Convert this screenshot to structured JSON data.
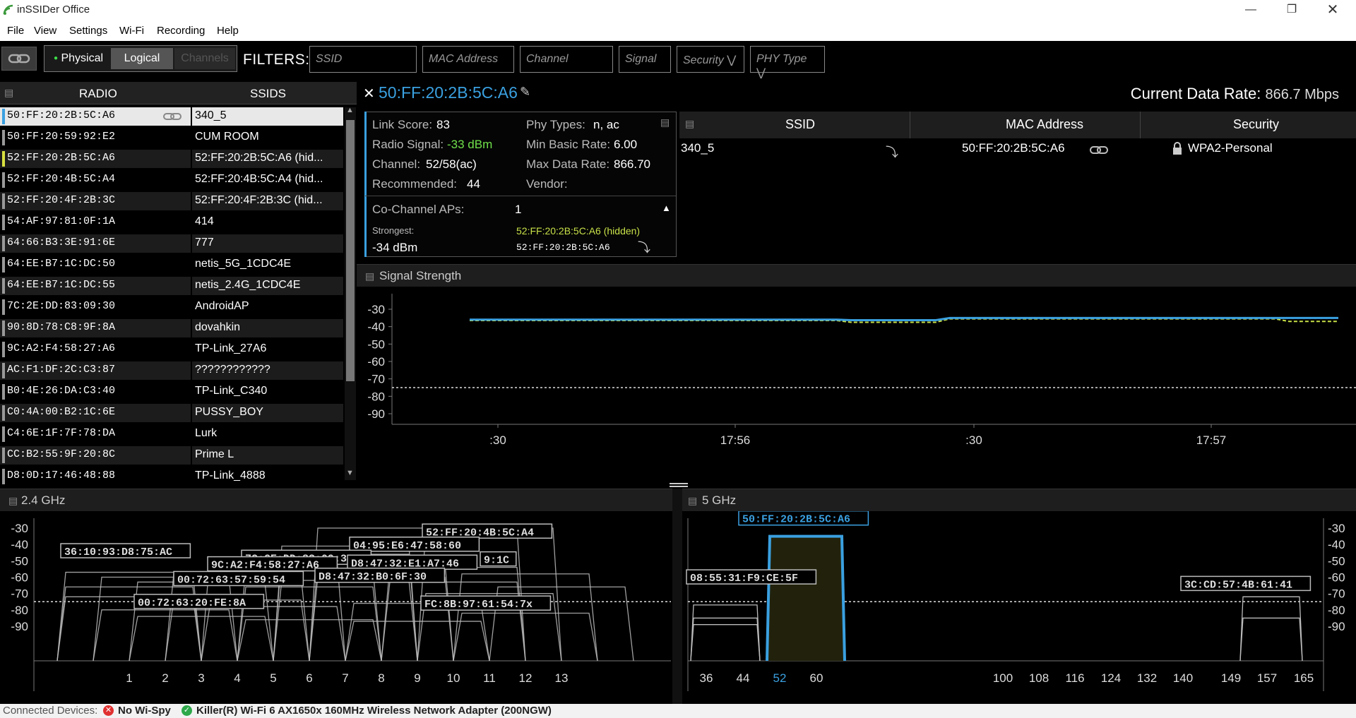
{
  "app": {
    "title": "inSSIDer Office"
  },
  "menu": [
    "File",
    "View",
    "Settings",
    "Wi-Fi",
    "Recording",
    "Help"
  ],
  "toolbar": {
    "view_physical": "Physical",
    "view_logical": "Logical",
    "view_channels": "Channels",
    "filters_label": "FILTERS:",
    "filter_ssid": "SSID",
    "filter_mac": "MAC Address",
    "filter_channel": "Channel",
    "filter_signal": "Signal",
    "filter_security": "Security",
    "filter_phy": "PHY Type"
  },
  "radiolist": {
    "col_radio": "RADIO",
    "col_ssids": "SSIDS",
    "rows": [
      {
        "mac": "50:FF:20:2B:5C:A6",
        "ssid": "340_5",
        "color": "#3aa0e0",
        "selected": true
      },
      {
        "mac": "50:FF:20:59:92:E2",
        "ssid": "CUM ROOM",
        "color": "#999999"
      },
      {
        "mac": "52:FF:20:2B:5C:A6",
        "ssid": "52:FF:20:2B:5C:A6 (hid...",
        "color": "#d8e040"
      },
      {
        "mac": "52:FF:20:4B:5C:A4",
        "ssid": "52:FF:20:4B:5C:A4 (hid...",
        "color": "#999999"
      },
      {
        "mac": "52:FF:20:4F:2B:3C",
        "ssid": "52:FF:20:4F:2B:3C (hid...",
        "color": "#999999"
      },
      {
        "mac": "54:AF:97:81:0F:1A",
        "ssid": "414",
        "color": "#999999"
      },
      {
        "mac": "64:66:B3:3E:91:6E",
        "ssid": "777",
        "color": "#999999"
      },
      {
        "mac": "64:EE:B7:1C:DC:50",
        "ssid": "netis_5G_1CDC4E",
        "color": "#999999"
      },
      {
        "mac": "64:EE:B7:1C:DC:55",
        "ssid": "netis_2.4G_1CDC4E",
        "color": "#999999"
      },
      {
        "mac": "7C:2E:DD:83:09:30",
        "ssid": "AndroidAP",
        "color": "#999999"
      },
      {
        "mac": "90:8D:78:C8:9F:8A",
        "ssid": "dovahkin",
        "color": "#999999"
      },
      {
        "mac": "9C:A2:F4:58:27:A6",
        "ssid": "TP-Link_27A6",
        "color": "#999999"
      },
      {
        "mac": "AC:F1:DF:2C:C3:87",
        "ssid": "????????????",
        "color": "#999999"
      },
      {
        "mac": "B0:4E:26:DA:C3:40",
        "ssid": "TP-Link_C340",
        "color": "#999999"
      },
      {
        "mac": "C0:4A:00:B2:1C:6E",
        "ssid": "PUSSY_BOY",
        "color": "#999999"
      },
      {
        "mac": "C4:6E:1F:7F:78:DA",
        "ssid": "Lurk",
        "color": "#999999"
      },
      {
        "mac": "CC:B2:55:9F:20:8C",
        "ssid": "Prime L",
        "color": "#999999"
      },
      {
        "mac": "D8:0D:17:46:48:88",
        "ssid": "TP-Link_4888",
        "color": "#999999"
      }
    ]
  },
  "detail": {
    "title": "50:FF:20:2B:5C:A6",
    "current_rate_label": "Current Data Rate:",
    "current_rate_value": "866.7 Mbps",
    "link_score_label": "Link Score:",
    "link_score": "83",
    "radio_signal_label": "Radio Signal:",
    "radio_signal": "-33 dBm",
    "channel_label": "Channel:",
    "channel": "52/58(ac)",
    "recommended_label": "Recommended:",
    "recommended": "44",
    "phy_label": "Phy Types:",
    "phy": "n, ac",
    "min_rate_label": "Min Basic Rate:",
    "min_rate": "6.00",
    "max_rate_label": "Max Data Rate:",
    "max_rate": "866.70",
    "vendor_label": "Vendor:",
    "cochannel_label": "Co-Channel APs:",
    "cochannel": "1",
    "strongest_label": "Strongest:",
    "strongest_name": "52:FF:20:2B:5C:A6 (hidden)",
    "strongest_signal": "-34 dBm",
    "strongest_mac": "52:FF:20:2B:5C:A6",
    "table": {
      "col_ssid": "SSID",
      "col_mac": "MAC Address",
      "col_security": "Security",
      "row": {
        "ssid": "340_5",
        "mac": "50:FF:20:2B:5C:A6",
        "security": "WPA2-Personal"
      }
    }
  },
  "signal_panel": {
    "title": "Signal Strength",
    "y_ticks": [
      "-30",
      "-40",
      "-50",
      "-60",
      "-70",
      "-80",
      "-90"
    ],
    "x_ticks": [
      ":30",
      "17:56",
      ":30",
      "17:57"
    ],
    "colors": {
      "primary": "#3aa0e0",
      "secondary": "#c8e048"
    }
  },
  "band24": {
    "title": "2.4 GHz",
    "y_ticks": [
      "-30",
      "-40",
      "-50",
      "-60",
      "-70",
      "-80",
      "-90"
    ],
    "channels": [
      "1",
      "2",
      "3",
      "4",
      "5",
      "6",
      "7",
      "8",
      "9",
      "10",
      "11",
      "12",
      "13"
    ],
    "labels": [
      "36:10:93:D8:75:AC",
      "52:FF:20:4B:5C:A4",
      "04:95:E6:47:58:60",
      "7C:2E:DD:83:09:30",
      "9C:A2:F4:58:27:A6",
      "D8:47:32:E1:A7:46",
      "9:1C",
      "00:72:63:57:59:54",
      "D8:47:32:B0:6F:30",
      "00:72:63:20:FE:8A",
      "FC:8B:97:61:54:7x"
    ]
  },
  "band5": {
    "title": "5 GHz",
    "y_ticks": [
      "-30",
      "-40",
      "-50",
      "-60",
      "-70",
      "-80",
      "-90"
    ],
    "channels": [
      "36",
      "44",
      "52",
      "60",
      "100",
      "108",
      "116",
      "124",
      "132",
      "140",
      "149",
      "157",
      "165"
    ],
    "selected_label": "50:FF:20:2B:5C:A6",
    "labels": [
      "08:55:31:F9:CE:5F",
      "3C:CD:57:4B:61:41"
    ]
  },
  "status": {
    "label": "Connected Devices:",
    "device1": "No Wi-Spy",
    "device2": "Killer(R) Wi-Fi 6 AX1650x 160MHz Wireless Network Adapter (200NGW)"
  }
}
